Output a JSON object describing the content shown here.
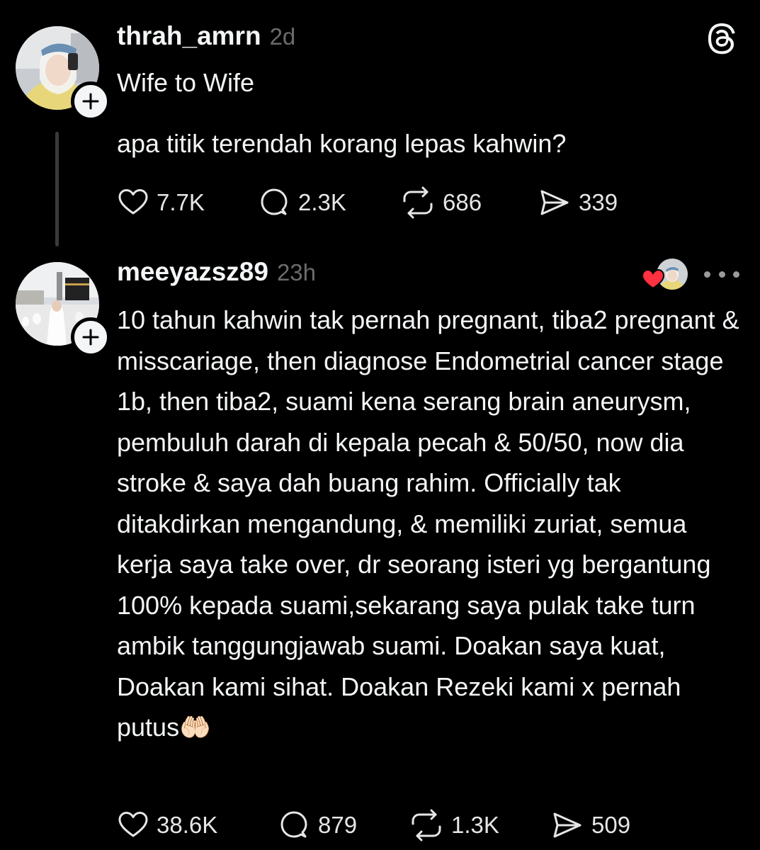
{
  "app": {
    "logo_icon": "threads-logo-icon",
    "accent_color": "#f3f5f7",
    "background_color": "#000000",
    "like_color": "#ff3040"
  },
  "posts": [
    {
      "username": "thrah_amrn",
      "time": "2d",
      "topic": "Wife to Wife",
      "text": "apa titik terendah korang lepas kahwin?",
      "stats": {
        "likes": "7.7K",
        "replies": "2.3K",
        "reposts": "686",
        "shares": "339"
      }
    },
    {
      "username": "meeyazsz89",
      "time": "23h",
      "text": "10 tahun kahwin tak pernah pregnant, tiba2 pregnant & misscariage, then diagnose Endometrial cancer stage 1b, then tiba2, suami kena serang brain aneurysm, pembuluh darah di kepala pecah & 50/50, now dia stroke & saya dah buang rahim. Officially tak ditakdirkan mengandung, & memiliki zuriat, semua kerja saya take over, dr seorang isteri yg bergantung 100% kepada suami,sekarang saya pulak take turn ambik tanggungjawab suami. Doakan saya kuat, Doakan kami sihat. Doakan Rezeki kami x pernah putus🤲🏻",
      "stats": {
        "likes": "38.6K",
        "replies": "879",
        "reposts": "1.3K",
        "shares": "509"
      }
    }
  ]
}
